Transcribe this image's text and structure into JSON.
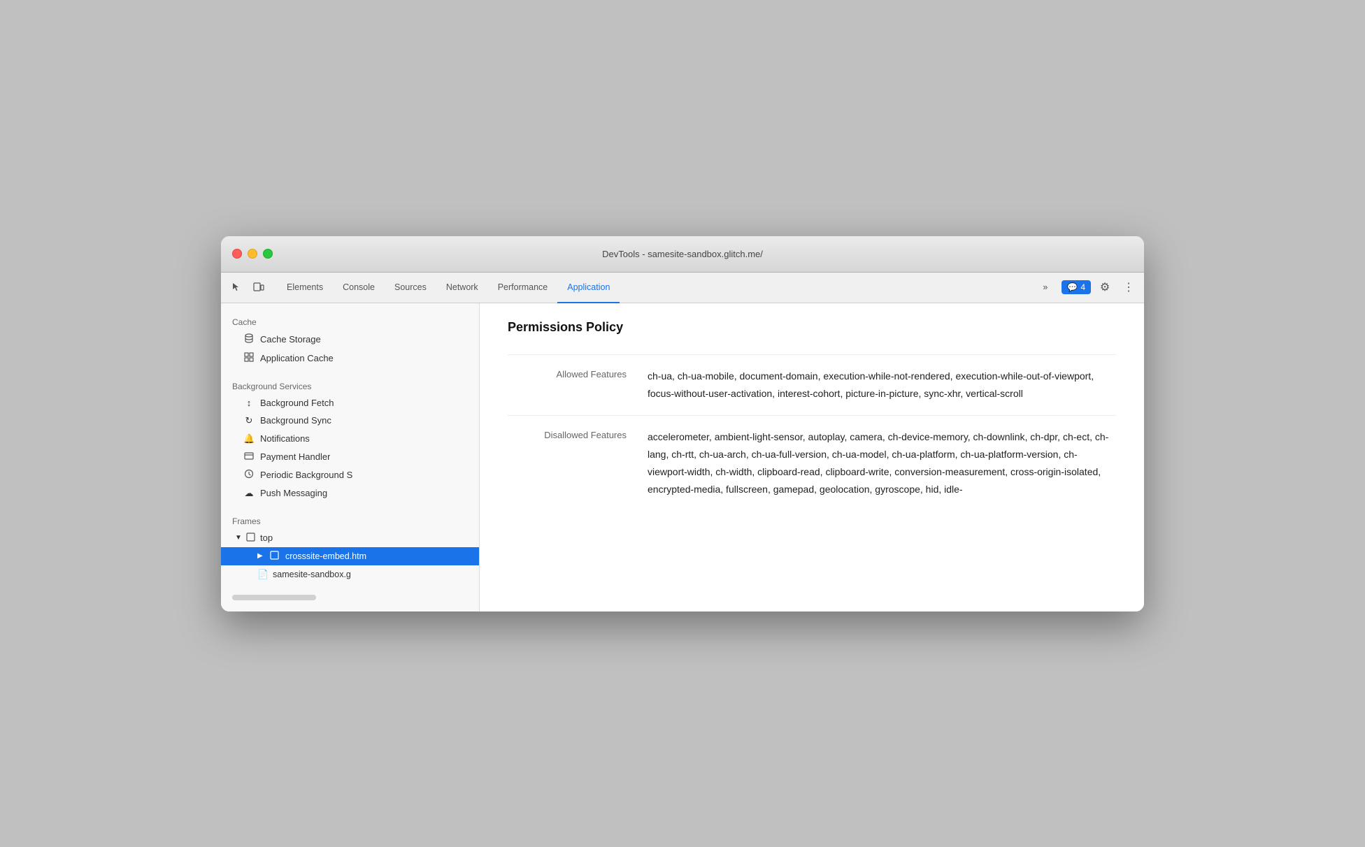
{
  "window": {
    "title": "DevTools - samesite-sandbox.glitch.me/"
  },
  "tabs": [
    {
      "id": "elements",
      "label": "Elements",
      "active": false
    },
    {
      "id": "console",
      "label": "Console",
      "active": false
    },
    {
      "id": "sources",
      "label": "Sources",
      "active": false
    },
    {
      "id": "network",
      "label": "Network",
      "active": false
    },
    {
      "id": "performance",
      "label": "Performance",
      "active": false
    },
    {
      "id": "application",
      "label": "Application",
      "active": true
    }
  ],
  "toolbar": {
    "more_tabs_label": "»",
    "badge_icon": "💬",
    "badge_count": "4",
    "settings_icon": "⚙",
    "more_icon": "⋮"
  },
  "sidebar": {
    "cache_section": "Cache",
    "cache_items": [
      {
        "id": "cache-storage",
        "icon": "🗄",
        "label": "Cache Storage"
      },
      {
        "id": "application-cache",
        "icon": "▦",
        "label": "Application Cache"
      }
    ],
    "background_section": "Background Services",
    "background_items": [
      {
        "id": "bg-fetch",
        "icon": "↕",
        "label": "Background Fetch"
      },
      {
        "id": "bg-sync",
        "icon": "↻",
        "label": "Background Sync"
      },
      {
        "id": "notifications",
        "icon": "🔔",
        "label": "Notifications"
      },
      {
        "id": "payment-handler",
        "icon": "💳",
        "label": "Payment Handler"
      },
      {
        "id": "periodic-bg",
        "icon": "🕐",
        "label": "Periodic Background S"
      },
      {
        "id": "push-messaging",
        "icon": "☁",
        "label": "Push Messaging"
      }
    ],
    "frames_section": "Frames",
    "frames_tree": {
      "top_label": "top",
      "top_icon": "□",
      "children": [
        {
          "id": "crosssite-embed",
          "label": "crosssite-embed.htm",
          "icon": "□",
          "active": true
        },
        {
          "id": "samesite-sandbox",
          "label": "samesite-sandbox.g",
          "icon": "📄",
          "active": false
        }
      ]
    }
  },
  "content": {
    "title": "Permissions Policy",
    "allowed_features_label": "Allowed Features",
    "allowed_features_value": "ch-ua, ch-ua-mobile, document-domain, execution-while-not-rendered, execution-while-out-of-viewport, focus-without-user-activation, interest-cohort, picture-in-picture, sync-xhr, vertical-scroll",
    "disallowed_features_label": "Disallowed Features",
    "disallowed_features_value": "accelerometer, ambient-light-sensor, autoplay, camera, ch-device-memory, ch-downlink, ch-dpr, ch-ect, ch-lang, ch-rtt, ch-ua-arch, ch-ua-full-version, ch-ua-model, ch-ua-platform, ch-ua-platform-version, ch-viewport-width, ch-width, clipboard-read, clipboard-write, conversion-measurement, cross-origin-isolated, encrypted-media, fullscreen, gamepad, geolocation, gyroscope, hid, idle-"
  }
}
